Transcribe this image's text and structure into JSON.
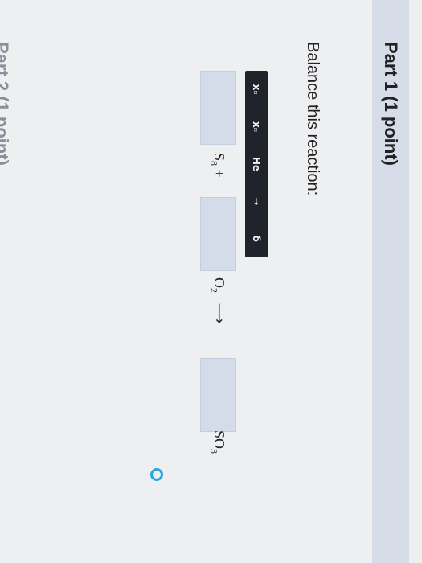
{
  "part": {
    "title": "Part 1   (1 point)",
    "next_title": "Part 2   (1 point)"
  },
  "instruction": "Balance this reaction:",
  "toolbar": {
    "buttons": [
      {
        "name": "subscript-button",
        "label": "x",
        "mark": "_"
      },
      {
        "name": "superscript-button",
        "label": "x",
        "mark": "^"
      },
      {
        "name": "element-button",
        "label": "He"
      },
      {
        "name": "arrow-button",
        "label": "→"
      },
      {
        "name": "delta-button",
        "label": "δ"
      }
    ]
  },
  "equation": {
    "reactant1": {
      "symbol": "S",
      "subscript": "8",
      "operator": "+"
    },
    "reactant2": {
      "symbol": "O",
      "subscript": "2",
      "arrow": "⟶"
    },
    "product1": {
      "symbol": "SO",
      "subscript": "3"
    }
  },
  "colors": {
    "accent": "#2aa6dc",
    "toolbar_bg": "#1f232a",
    "input_box_bg": "#d4dcea"
  }
}
